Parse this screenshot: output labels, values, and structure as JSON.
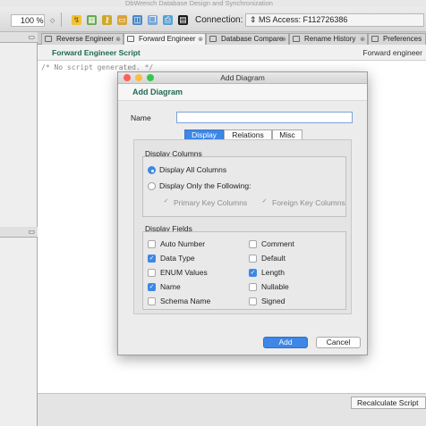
{
  "app_title": "DbWrench Database Design and Synchronization",
  "toolbar": {
    "zoom": "100 %",
    "connection_label": "Connection:",
    "connection_value": "MS Access: F112726386"
  },
  "tabs": [
    {
      "label": "Reverse Engineer"
    },
    {
      "label": "Forward Engineer"
    },
    {
      "label": "Database Compare"
    },
    {
      "label": "Rename History"
    },
    {
      "label": "Preferences"
    }
  ],
  "editor": {
    "title": "Forward Engineer Script",
    "right_label": "Forward engineer",
    "script_text": "/* No script generated. */"
  },
  "bottom": {
    "recalc_label": "Recalculate Script"
  },
  "dialog": {
    "window_title": "Add Diagram",
    "heading": "Add Diagram",
    "name_label": "Name",
    "name_value": "",
    "tabs": [
      "Display",
      "Relations",
      "Misc"
    ],
    "active_tab": "Display",
    "columns_group": {
      "title": "Display Columns",
      "all": "Display All Columns",
      "only": "Display Only the Following:",
      "pk": "Primary Key Columns",
      "fk": "Foreign Key Columns"
    },
    "fields_group": {
      "title": "Display Fields",
      "fields": [
        {
          "label": "Auto Number",
          "checked": false
        },
        {
          "label": "Comment",
          "checked": false
        },
        {
          "label": "Data Type",
          "checked": true
        },
        {
          "label": "Default",
          "checked": false
        },
        {
          "label": "ENUM Values",
          "checked": false
        },
        {
          "label": "Length",
          "checked": true
        },
        {
          "label": "Name",
          "checked": true
        },
        {
          "label": "Nullable",
          "checked": false
        },
        {
          "label": "Schema Name",
          "checked": false
        },
        {
          "label": "Signed",
          "checked": false
        }
      ]
    },
    "add_label": "Add",
    "cancel_label": "Cancel"
  }
}
